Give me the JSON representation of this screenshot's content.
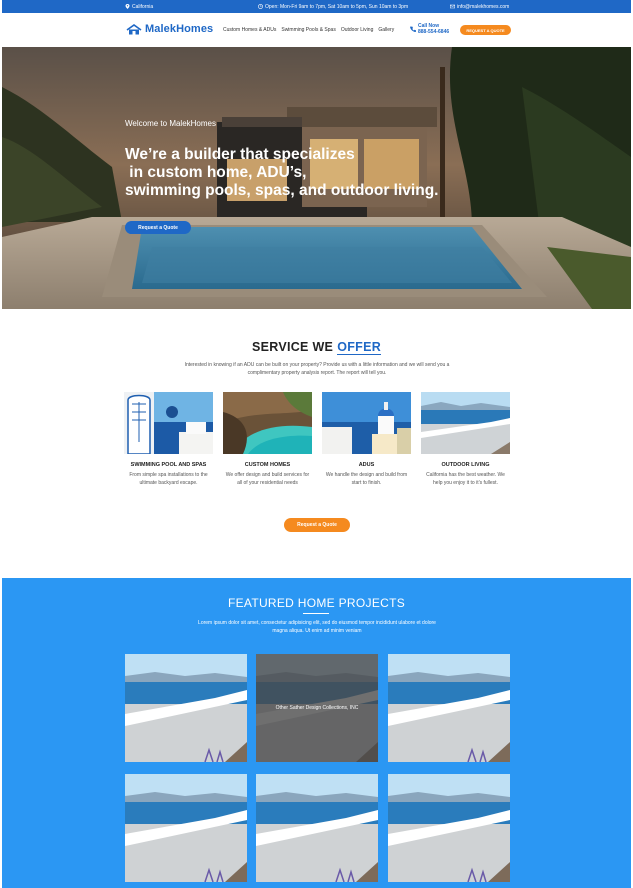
{
  "topbar": {
    "location": "California",
    "hours": "Open: Mon-Fri 9am to 7pm, Sat 10am to 5pm, Sun 10am to 3pm",
    "email": "info@malekhomes.com",
    "location_icon": "map-pin-icon",
    "hours_icon": "clock-icon",
    "email_icon": "envelope-icon"
  },
  "header": {
    "logo_text": "MalekHomes",
    "logo_icon": "house-icon",
    "menu": [
      {
        "label": "Custom Homes & ADUs"
      },
      {
        "label": "Swimming Pools & Spas"
      },
      {
        "label": "Outdoor Living"
      },
      {
        "label": "Gallery"
      }
    ],
    "call_label": "Call Now",
    "call_number": "888-554-6846",
    "call_icon": "phone-icon",
    "quote_button": "REQUEST A QUOTE"
  },
  "hero": {
    "welcome": "Welcome to MalekHomes",
    "title_lines": [
      "We’re a builder that specializes",
      " in custom home, ADU’s,",
      "swimming pools, spas, and outdoor living."
    ],
    "button": "Request a Quote"
  },
  "services": {
    "title_plain": "SERVICE WE",
    "title_highlight": "OFFER",
    "description": "Interested in knowing if an ADU can be built on your property? Provide us with a little information and we will send you a complimentary property analysis report. The report will tell you.",
    "items": [
      {
        "title": "SWIMMING POOL AND SPAS",
        "text": "From simple spa installations to the ultimate backyard escape."
      },
      {
        "title": "CUSTOM HOMES",
        "text": "We offer design and build services for all of your residential needs"
      },
      {
        "title": "ADUS",
        "text": "We handle the design and build from start to finish."
      },
      {
        "title": "OUTDOOR LIVING",
        "text": "California has the best weather. We help you enjoy it to it’s fullest."
      }
    ],
    "button": "Request a Quote"
  },
  "featured": {
    "title": "FEATURED HOME PROJECTS",
    "description": "Lorem ipsum dolor sit amet, consectetur adipisicing elit, sed do eiusmod tempor incididunt ulabore et dolore magna aliqua. Ut enim ad minim veniam",
    "overlay_text": "Other Sather Design Collections, INC"
  },
  "colors": {
    "primary": "#1f68c6",
    "accent": "#f58a1f",
    "featured_bg": "#2b97f3"
  }
}
